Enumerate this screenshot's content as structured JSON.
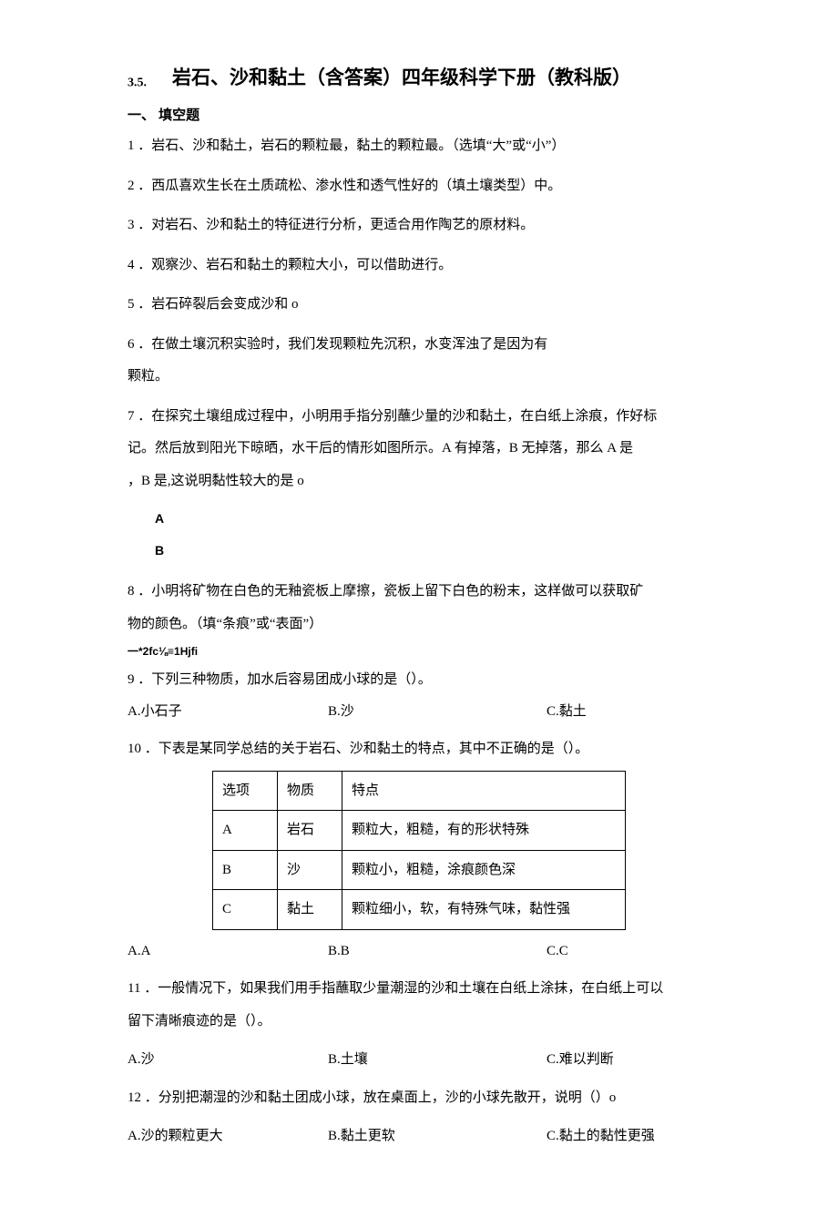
{
  "title": {
    "num": "3.5.",
    "main": "岩石、沙和黏土（含答案）四年级科学下册（教科版）"
  },
  "section1": "一、 填空题",
  "q1": "1 ．岩石、沙和黏土，岩石的颗粒最，黏土的颗粒最。（选填“大”或“小”）",
  "q2": "2 ．西瓜喜欢生长在土质疏松、渗水性和透气性好的（填土壤类型）中。",
  "q3": "3 ．对岩石、沙和黏土的特征进行分析，更适合用作陶艺的原材料。",
  "q4": "4 ．观察沙、岩石和黏土的颗粒大小，可以借助进行。",
  "q5": "5 ．岩石碎裂后会变成沙和 o",
  "q6": "6 ．在做土壤沉积实验时，我们发现颗粒先沉积，水变浑浊了是因为有",
  "q6b": "颗粒。",
  "q7a": "7 ．在探究土壤组成过程中，小明用手指分别蘸少量的沙和黏土，在白纸上涂痕，作好标",
  "q7b": "记。然后放到阳光下晾晒，水干后的情形如图所示。A 有掉落，B 无掉落，那么 A 是",
  "q7c": "，B 是,这说明黏性较大的是 o",
  "ab": {
    "a": "A",
    "b": "B"
  },
  "q8a": "8 ．小明将矿物在白色的无釉瓷板上摩擦，瓷板上留下白色的粉末，这样做可以获取矿",
  "q8b": "物的颜色。（填“条痕”或“表面”）",
  "garble": "一*2fc⅛≡1Hjfi",
  "q9": "9 ．下列三种物质，加水后容易团成小球的是（）。",
  "q9o": {
    "a": "A.小石子",
    "b": "B.沙",
    "c": "C.黏土"
  },
  "q10": "10 ．下表是某同学总结的关于岩石、沙和黏土的特点，其中不正确的是（）。",
  "table": {
    "h1": "选项",
    "h2": "物质",
    "h3": "特点",
    "r1c1": "A",
    "r1c2": "岩石",
    "r1c3": "颗粒大，粗糙，有的形状特殊",
    "r2c1": "B",
    "r2c2": "沙",
    "r2c3": "颗粒小，粗糙，涂痕颜色深",
    "r3c1": "C",
    "r3c2": "黏土",
    "r3c3": "颗粒细小，软，有特殊气味，黏性强"
  },
  "q10o": {
    "a": "A.A",
    "b": "B.B",
    "c": "C.C"
  },
  "q11a": "11 ．一般情况下，如果我们用手指蘸取少量潮湿的沙和土壤在白纸上涂抹，在白纸上可以",
  "q11b": "留下清晰痕迹的是（）。",
  "q11o": {
    "a": "A.沙",
    "b": "B.土壤",
    "c": "C.难以判断"
  },
  "q12": "12 ．分别把潮湿的沙和黏土团成小球，放在桌面上，沙的小球先散开，说明（）o",
  "q12o": {
    "a": "A.沙的颗粒更大",
    "b": "B.黏土更软",
    "c": "C.黏土的黏性更强"
  }
}
